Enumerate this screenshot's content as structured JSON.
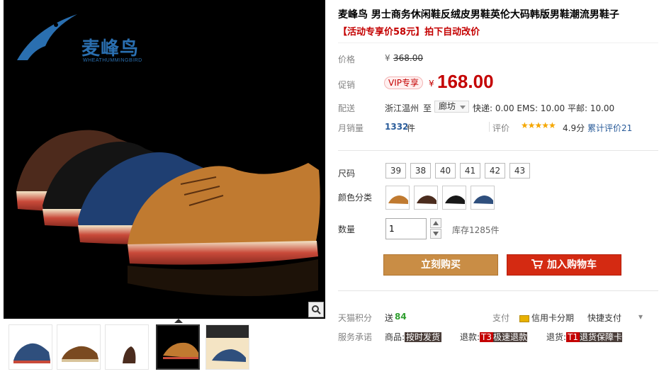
{
  "brand": {
    "name": "麦峰鸟",
    "sub": "WHEATHUMMINGBIRD"
  },
  "product": {
    "title": "麦峰鸟 男士商务休闲鞋反绒皮男鞋英伦大码韩版男鞋潮流男鞋子",
    "promo": "【活动专享价58元】拍下自动改价"
  },
  "price": {
    "label": "价格",
    "currency": "¥",
    "original": "368.00",
    "promo_label": "促销",
    "vip_tag": "VIP专享",
    "promo_currency": "¥",
    "promo_price": "168.00"
  },
  "delivery": {
    "label": "配送",
    "from": "浙江温州",
    "to_word": "至",
    "city": "廊坊",
    "fees": "快递: 0.00 EMS: 10.00 平邮: 10.00"
  },
  "sales": {
    "label": "月销量",
    "count": "1332",
    "unit": "件",
    "rating_label": "评价",
    "stars": "★★★★★",
    "score": "4.9分",
    "total_reviews": "累计评价21"
  },
  "options": {
    "size_label": "尺码",
    "sizes": [
      "39",
      "38",
      "40",
      "41",
      "42",
      "43"
    ],
    "color_label": "颜色分类",
    "colors": [
      "#c07a30",
      "#4b2c1e",
      "#181818",
      "#2f4f7d"
    ],
    "qty_label": "数量",
    "qty_value": "1",
    "stock": "库存1285件"
  },
  "actions": {
    "buy": "立刻购买",
    "cart": "加入购物车"
  },
  "footer": {
    "points_label": "天猫积分",
    "points_prefix": "送",
    "points_value": "84",
    "pay_label": "支付",
    "pay_credit": "信用卡分期",
    "pay_quick": "快捷支付",
    "promise_label": "服务承诺",
    "goods_prefix": "商品:",
    "goods_badge": "按时发货",
    "refund_prefix": "退款:",
    "refund_t": "T3",
    "refund_badge": "极速退款",
    "return_prefix": "退货:",
    "return_t": "T1",
    "return_badge": "退货保障卡"
  }
}
